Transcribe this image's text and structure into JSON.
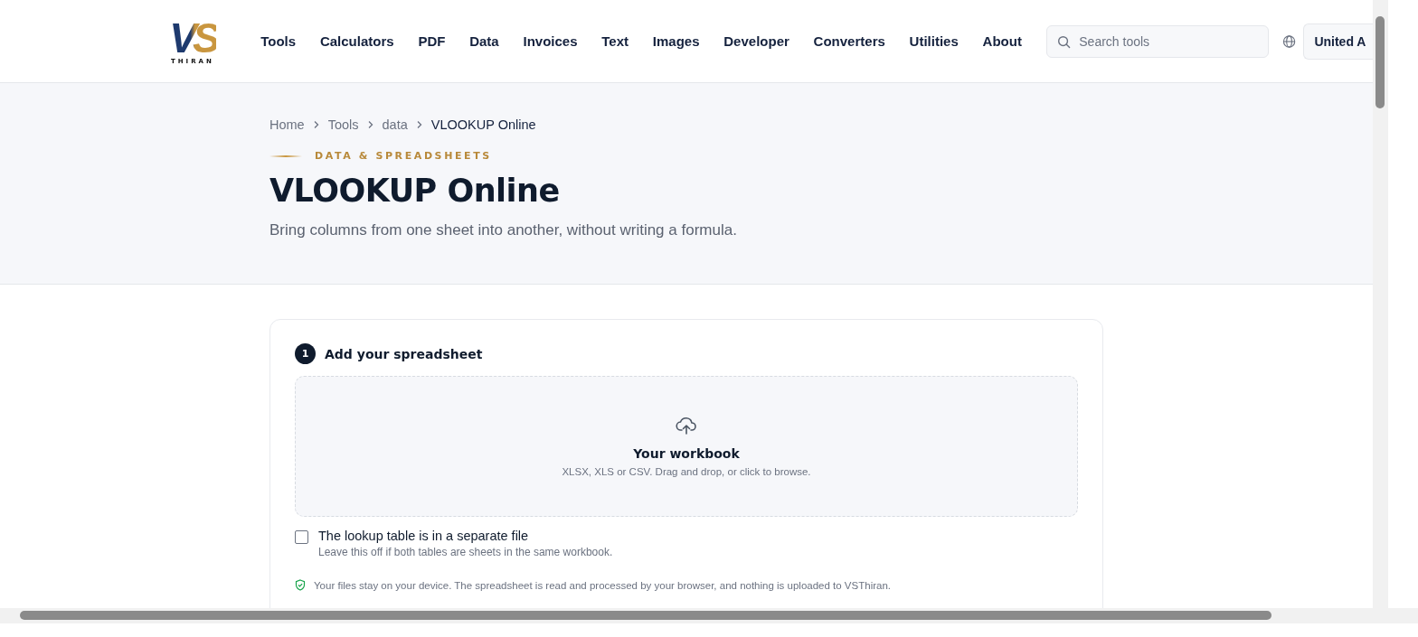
{
  "logo": {
    "mark": "VS",
    "wordmark": "THIRAN"
  },
  "nav": [
    {
      "label": "Tools"
    },
    {
      "label": "Calculators"
    },
    {
      "label": "PDF"
    },
    {
      "label": "Data"
    },
    {
      "label": "Invoices"
    },
    {
      "label": "Text"
    },
    {
      "label": "Images"
    },
    {
      "label": "Developer"
    },
    {
      "label": "Converters"
    },
    {
      "label": "Utilities"
    },
    {
      "label": "About"
    }
  ],
  "search": {
    "placeholder": "Search tools"
  },
  "language_button": "United A",
  "breadcrumb": [
    {
      "label": "Home",
      "current": false
    },
    {
      "label": "Tools",
      "current": false
    },
    {
      "label": "data",
      "current": false
    },
    {
      "label": "VLOOKUP Online",
      "current": true
    }
  ],
  "eyebrow": "DATA & SPREADSHEETS",
  "title": "VLOOKUP Online",
  "subtitle": "Bring columns from one sheet into another, without writing a formula.",
  "step": {
    "number": "1",
    "title": "Add your spreadsheet"
  },
  "dropzone": {
    "title": "Your workbook",
    "hint": "XLSX, XLS or CSV. Drag and drop, or click to browse."
  },
  "separate_file": {
    "label": "The lookup table is in a separate file",
    "hint": "Leave this off if both tables are sheets in the same workbook.",
    "checked": false
  },
  "privacy_note": "Your files stay on your device. The spreadsheet is read and processed by your browser, and nothing is uploaded to VSThiran."
}
